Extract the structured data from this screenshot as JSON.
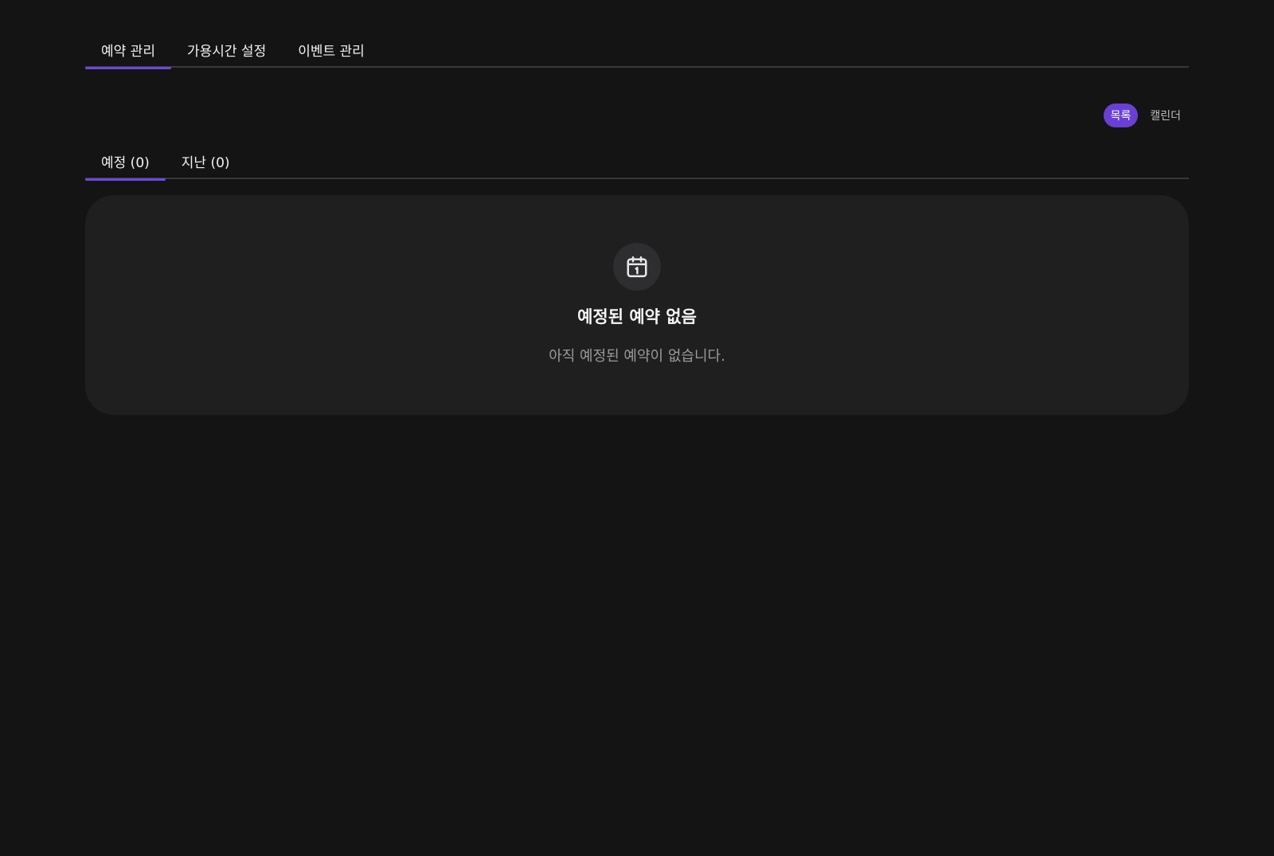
{
  "top_tabs": [
    {
      "label": "예약 관리",
      "active": true
    },
    {
      "label": "가용시간 설정",
      "active": false
    },
    {
      "label": "이벤트 관리",
      "active": false
    }
  ],
  "view_toggle": {
    "list_label": "목록",
    "calendar_label": "캘린더",
    "selected": "목록"
  },
  "sub_tabs": [
    {
      "label": "예정 (0)",
      "active": true
    },
    {
      "label": "지난 (0)",
      "active": false
    }
  ],
  "empty_state": {
    "icon": "calendar-icon",
    "title": "예정된 예약 없음",
    "description": "아직 예정된 예약이 없습니다."
  },
  "colors": {
    "background": "#141414",
    "card": "#1f1f1f",
    "accent": "#6a3fd6",
    "divider": "#38373c"
  }
}
